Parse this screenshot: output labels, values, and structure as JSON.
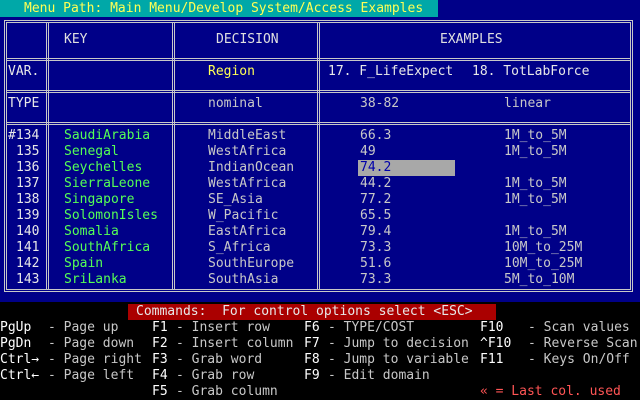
{
  "menu_path": "Menu Path: Main Menu/Develop System/Access Examples",
  "table": {
    "headers": {
      "key": "KEY",
      "decision": "DECISION",
      "examples": "EXAMPLES"
    },
    "var_row": {
      "label": "VAR.",
      "decision": "Region",
      "examples_1": "17. F_LifeExpect",
      "examples_2": "18. TotLabForce"
    },
    "type_row": {
      "label": "TYPE",
      "decision": "nominal",
      "examples_1": "38-82",
      "examples_2": "linear"
    },
    "rows": [
      {
        "num": "#134",
        "key": "SaudiArabia",
        "decision": "MiddleEast",
        "v1": "66.3",
        "v2": "1M_to_5M"
      },
      {
        "num": "135",
        "key": "Senegal",
        "decision": "WestAfrica",
        "v1": "49",
        "v2": "1M_to_5M"
      },
      {
        "num": "136",
        "key": "Seychelles",
        "decision": "IndianOcean",
        "v1": "74.2",
        "v2": ""
      },
      {
        "num": "137",
        "key": "SierraLeone",
        "decision": "WestAfrica",
        "v1": "44.2",
        "v2": "1M_to_5M"
      },
      {
        "num": "138",
        "key": "Singapore",
        "decision": "SE_Asia",
        "v1": "77.2",
        "v2": "1M_to_5M"
      },
      {
        "num": "139",
        "key": "SolomonIsles",
        "decision": "W_Pacific",
        "v1": "65.5",
        "v2": ""
      },
      {
        "num": "140",
        "key": "Somalia",
        "decision": "EastAfrica",
        "v1": "79.4",
        "v2": "1M_to_5M"
      },
      {
        "num": "141",
        "key": "SouthAfrica",
        "decision": "S_Africa",
        "v1": "73.3",
        "v2": "10M_to_25M"
      },
      {
        "num": "142",
        "key": "Spain",
        "decision": "SouthEurope",
        "v1": "51.6",
        "v2": "10M_to_25M"
      },
      {
        "num": "143",
        "key": "SriLanka",
        "decision": "SouthAsia",
        "v1": "73.3",
        "v2": "5M_to_10M"
      }
    ]
  },
  "commands_bar": "Commands:  For control options select <ESC>",
  "shortcuts": {
    "pgup": {
      "key": "PgUp",
      "desc": "- Page up"
    },
    "pgdn": {
      "key": "PgDn",
      "desc": "- Page down"
    },
    "ctrl_right": {
      "key": "Ctrl→",
      "desc": "- Page right"
    },
    "ctrl_left": {
      "key": "Ctrl←",
      "desc": "- Page left"
    },
    "f1": {
      "key": "F1",
      "desc": "- Insert row"
    },
    "f2": {
      "key": "F2",
      "desc": "- Insert column"
    },
    "f3": {
      "key": "F3",
      "desc": "- Grab word"
    },
    "f4": {
      "key": "F4",
      "desc": "- Grab row"
    },
    "f5": {
      "key": "F5",
      "desc": "- Grab column"
    },
    "f6": {
      "key": "F6",
      "desc": "- TYPE/COST"
    },
    "f7": {
      "key": "F7",
      "desc": "- Jump to decision"
    },
    "f8": {
      "key": "F8",
      "desc": "- Jump to variable"
    },
    "f9": {
      "key": "F9",
      "desc": "- Edit domain"
    },
    "f10": {
      "key": "F10",
      "desc": "- Scan values"
    },
    "cf10": {
      "key": "^F10",
      "desc": "- Reverse Scan"
    },
    "f11": {
      "key": "F11",
      "desc": "- Keys On/Off"
    },
    "last_col": "« = Last col. used"
  },
  "colors": {
    "background": "#000088",
    "menu_bar": "#00a8a8",
    "command_bar": "#aa0000",
    "key_text": "#55ff55",
    "highlight": "#ffff55",
    "selection": "#a8a8a8"
  }
}
